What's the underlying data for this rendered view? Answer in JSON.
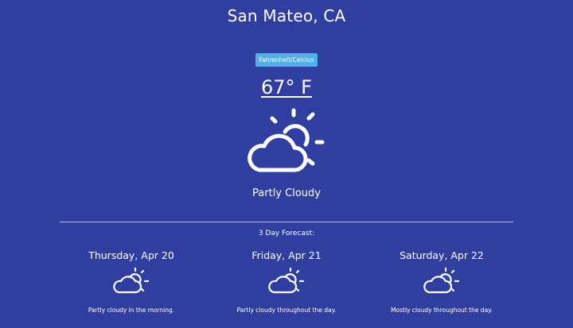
{
  "location": "San Mateo, CA",
  "unit_toggle_label": "Fahrenheit/Celcius",
  "current": {
    "temperature": "67° F",
    "condition": "Partly Cloudy",
    "icon": "partly-cloudy-icon"
  },
  "forecast_title": "3 Day Forecast:",
  "forecast": [
    {
      "day": "Thursday, Apr 20",
      "description": "Partly cloudy in the morning.",
      "icon": "partly-cloudy-icon"
    },
    {
      "day": "Friday, Apr 21",
      "description": "Partly cloudy throughout the day.",
      "icon": "partly-cloudy-icon"
    },
    {
      "day": "Saturday, Apr 22",
      "description": "Mostly cloudy throughout the day.",
      "icon": "partly-cloudy-icon"
    }
  ],
  "colors": {
    "background": "#303f9f",
    "toggle": "#4fb1e8",
    "text": "#ffffff"
  }
}
